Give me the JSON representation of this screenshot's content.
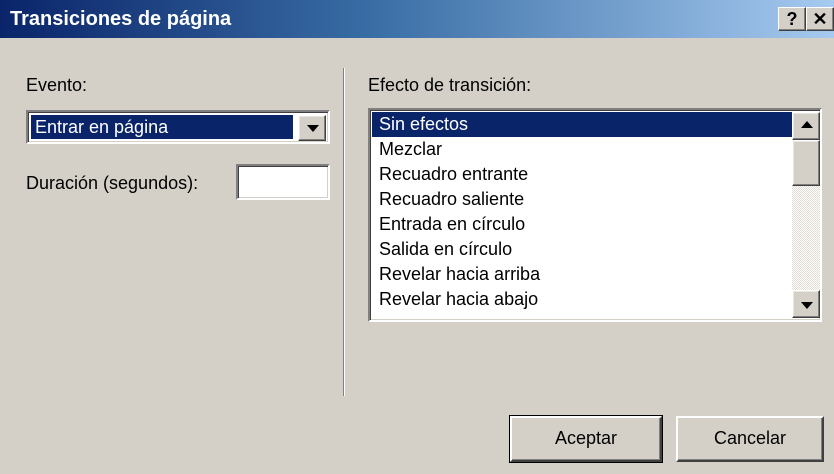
{
  "window": {
    "title": "Transiciones de página",
    "help_label": "?",
    "close_label": "✕"
  },
  "event": {
    "label": "Evento:",
    "selected": "Entrar en página"
  },
  "duration": {
    "label": "Duración (segundos):",
    "value": ""
  },
  "transition": {
    "label": "Efecto de transición:",
    "items": [
      "Sin efectos",
      "Mezclar",
      "Recuadro entrante",
      "Recuadro saliente",
      "Entrada en círculo",
      "Salida en círculo",
      "Revelar hacia arriba",
      "Revelar hacia abajo"
    ],
    "selected_index": 0
  },
  "buttons": {
    "ok": "Aceptar",
    "cancel": "Cancelar"
  },
  "colors": {
    "titlebar_start": "#0a246a",
    "titlebar_end": "#a6caf0",
    "selection": "#0a246a",
    "face": "#d4d0c8"
  },
  "icons": {
    "dropdown": "chevron-down-icon",
    "scroll_up": "arrow-up-icon",
    "scroll_down": "arrow-down-icon",
    "help": "help-icon",
    "close": "close-icon"
  }
}
